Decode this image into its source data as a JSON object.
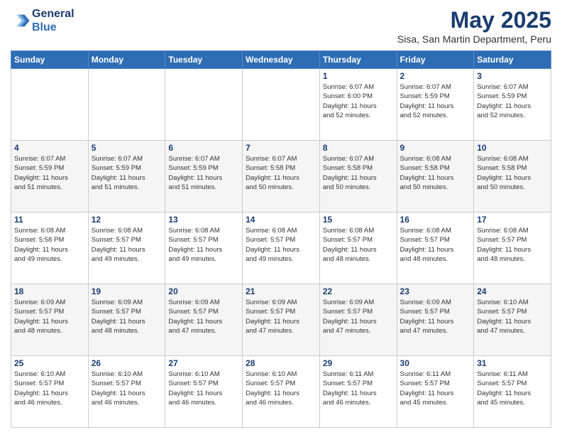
{
  "logo": {
    "line1": "General",
    "line2": "Blue"
  },
  "title": "May 2025",
  "subtitle": "Sisa, San Martin Department, Peru",
  "days_of_week": [
    "Sunday",
    "Monday",
    "Tuesday",
    "Wednesday",
    "Thursday",
    "Friday",
    "Saturday"
  ],
  "weeks": [
    [
      {
        "day": "",
        "info": ""
      },
      {
        "day": "",
        "info": ""
      },
      {
        "day": "",
        "info": ""
      },
      {
        "day": "",
        "info": ""
      },
      {
        "day": "1",
        "info": "Sunrise: 6:07 AM\nSunset: 6:00 PM\nDaylight: 11 hours\nand 52 minutes."
      },
      {
        "day": "2",
        "info": "Sunrise: 6:07 AM\nSunset: 5:59 PM\nDaylight: 11 hours\nand 52 minutes."
      },
      {
        "day": "3",
        "info": "Sunrise: 6:07 AM\nSunset: 5:59 PM\nDaylight: 11 hours\nand 52 minutes."
      }
    ],
    [
      {
        "day": "4",
        "info": "Sunrise: 6:07 AM\nSunset: 5:59 PM\nDaylight: 11 hours\nand 51 minutes."
      },
      {
        "day": "5",
        "info": "Sunrise: 6:07 AM\nSunset: 5:59 PM\nDaylight: 11 hours\nand 51 minutes."
      },
      {
        "day": "6",
        "info": "Sunrise: 6:07 AM\nSunset: 5:59 PM\nDaylight: 11 hours\nand 51 minutes."
      },
      {
        "day": "7",
        "info": "Sunrise: 6:07 AM\nSunset: 5:58 PM\nDaylight: 11 hours\nand 50 minutes."
      },
      {
        "day": "8",
        "info": "Sunrise: 6:07 AM\nSunset: 5:58 PM\nDaylight: 11 hours\nand 50 minutes."
      },
      {
        "day": "9",
        "info": "Sunrise: 6:08 AM\nSunset: 5:58 PM\nDaylight: 11 hours\nand 50 minutes."
      },
      {
        "day": "10",
        "info": "Sunrise: 6:08 AM\nSunset: 5:58 PM\nDaylight: 11 hours\nand 50 minutes."
      }
    ],
    [
      {
        "day": "11",
        "info": "Sunrise: 6:08 AM\nSunset: 5:58 PM\nDaylight: 11 hours\nand 49 minutes."
      },
      {
        "day": "12",
        "info": "Sunrise: 6:08 AM\nSunset: 5:57 PM\nDaylight: 11 hours\nand 49 minutes."
      },
      {
        "day": "13",
        "info": "Sunrise: 6:08 AM\nSunset: 5:57 PM\nDaylight: 11 hours\nand 49 minutes."
      },
      {
        "day": "14",
        "info": "Sunrise: 6:08 AM\nSunset: 5:57 PM\nDaylight: 11 hours\nand 49 minutes."
      },
      {
        "day": "15",
        "info": "Sunrise: 6:08 AM\nSunset: 5:57 PM\nDaylight: 11 hours\nand 48 minutes."
      },
      {
        "day": "16",
        "info": "Sunrise: 6:08 AM\nSunset: 5:57 PM\nDaylight: 11 hours\nand 48 minutes."
      },
      {
        "day": "17",
        "info": "Sunrise: 6:08 AM\nSunset: 5:57 PM\nDaylight: 11 hours\nand 48 minutes."
      }
    ],
    [
      {
        "day": "18",
        "info": "Sunrise: 6:09 AM\nSunset: 5:57 PM\nDaylight: 11 hours\nand 48 minutes."
      },
      {
        "day": "19",
        "info": "Sunrise: 6:09 AM\nSunset: 5:57 PM\nDaylight: 11 hours\nand 48 minutes."
      },
      {
        "day": "20",
        "info": "Sunrise: 6:09 AM\nSunset: 5:57 PM\nDaylight: 11 hours\nand 47 minutes."
      },
      {
        "day": "21",
        "info": "Sunrise: 6:09 AM\nSunset: 5:57 PM\nDaylight: 11 hours\nand 47 minutes."
      },
      {
        "day": "22",
        "info": "Sunrise: 6:09 AM\nSunset: 5:57 PM\nDaylight: 11 hours\nand 47 minutes."
      },
      {
        "day": "23",
        "info": "Sunrise: 6:09 AM\nSunset: 5:57 PM\nDaylight: 11 hours\nand 47 minutes."
      },
      {
        "day": "24",
        "info": "Sunrise: 6:10 AM\nSunset: 5:57 PM\nDaylight: 11 hours\nand 47 minutes."
      }
    ],
    [
      {
        "day": "25",
        "info": "Sunrise: 6:10 AM\nSunset: 5:57 PM\nDaylight: 11 hours\nand 46 minutes."
      },
      {
        "day": "26",
        "info": "Sunrise: 6:10 AM\nSunset: 5:57 PM\nDaylight: 11 hours\nand 46 minutes."
      },
      {
        "day": "27",
        "info": "Sunrise: 6:10 AM\nSunset: 5:57 PM\nDaylight: 11 hours\nand 46 minutes."
      },
      {
        "day": "28",
        "info": "Sunrise: 6:10 AM\nSunset: 5:57 PM\nDaylight: 11 hours\nand 46 minutes."
      },
      {
        "day": "29",
        "info": "Sunrise: 6:11 AM\nSunset: 5:57 PM\nDaylight: 11 hours\nand 46 minutes."
      },
      {
        "day": "30",
        "info": "Sunrise: 6:11 AM\nSunset: 5:57 PM\nDaylight: 11 hours\nand 45 minutes."
      },
      {
        "day": "31",
        "info": "Sunrise: 6:11 AM\nSunset: 5:57 PM\nDaylight: 11 hours\nand 45 minutes."
      }
    ]
  ]
}
